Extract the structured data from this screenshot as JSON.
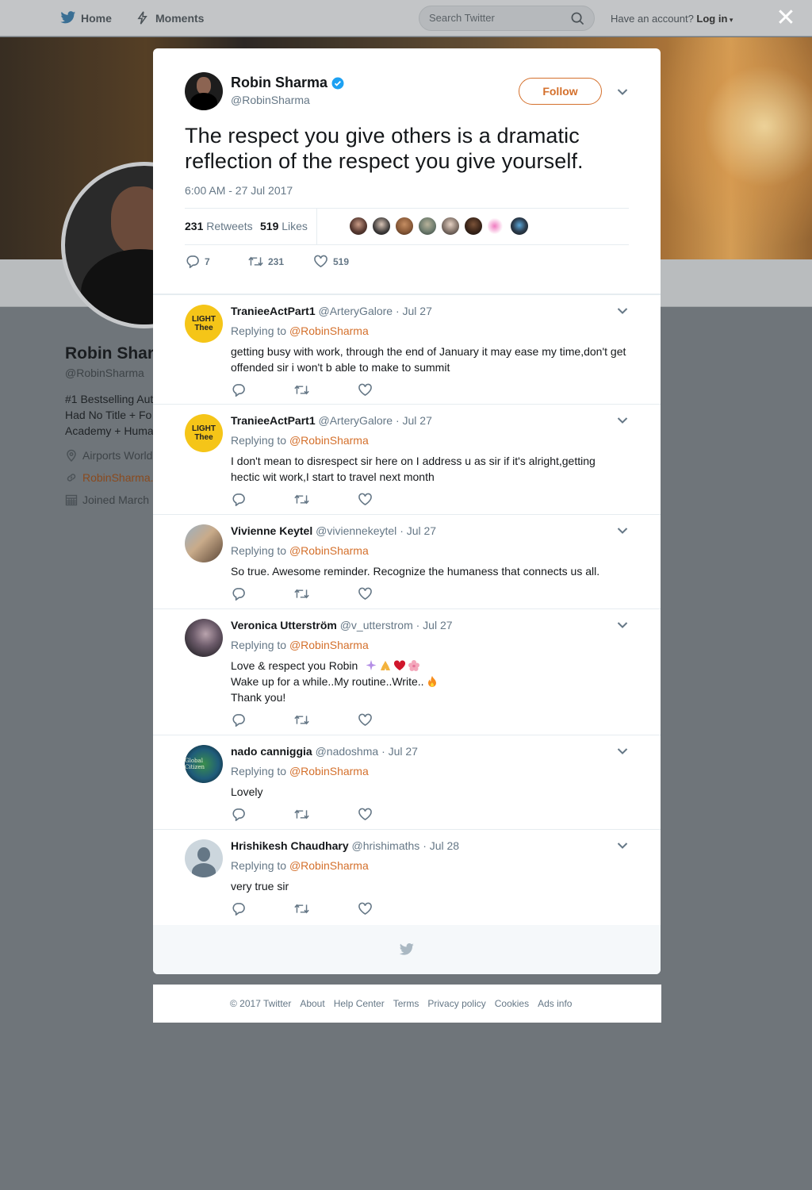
{
  "nav": {
    "home": "Home",
    "moments": "Moments",
    "search_placeholder": "Search Twitter",
    "account_prompt": "Have an account?",
    "login": "Log in"
  },
  "profile": {
    "name": "Robin Shar",
    "handle": "@RobinSharma",
    "bio": [
      "#1 Bestselling Aut",
      "Had No Title + Fo",
      "Academy + Huma"
    ],
    "location": "Airports World",
    "website": "RobinSharma.",
    "joined": "Joined March"
  },
  "tweet": {
    "name": "Robin Sharma",
    "handle": "@RobinSharma",
    "follow_label": "Follow",
    "text": "The respect you give others is a dramatic reflection of the respect you give yourself.",
    "timestamp": "6:00 AM - 27 Jul 2017",
    "retweets_count": "231",
    "retweets_label": "Retweets",
    "likes_count": "519",
    "likes_label": "Likes",
    "reply_count": "7",
    "retweet_count": "231",
    "like_count": "519"
  },
  "replies": [
    {
      "name": "TranieeActPart1",
      "handle": "@ArteryGalore",
      "date": "· Jul 27",
      "replying_prefix": "Replying to",
      "replying_to": "@RobinSharma",
      "lines": [
        "getting busy with work, through the end of January it may ease my time,don't get offended sir i won't b able to make to summit"
      ],
      "avatar_text": [
        "LIGHT",
        "Thee"
      ]
    },
    {
      "name": "TranieeActPart1",
      "handle": "@ArteryGalore",
      "date": "· Jul 27",
      "replying_prefix": "Replying to",
      "replying_to": "@RobinSharma",
      "lines": [
        "I don't mean to disrespect sir here on I address u as sir if it's alright,getting hectic wit work,I start to travel next month"
      ],
      "avatar_text": [
        "LIGHT",
        "Thee"
      ]
    },
    {
      "name": "Vivienne Keytel",
      "handle": "@viviennekeytel",
      "date": "· Jul 27",
      "replying_prefix": "Replying to",
      "replying_to": "@RobinSharma",
      "lines": [
        "So true. Awesome reminder. Recognize the humaness that connects us all."
      ]
    },
    {
      "name": "Veronica Utterström",
      "handle": "@v_utterstrom",
      "date": "· Jul 27",
      "replying_prefix": "Replying to",
      "replying_to": "@RobinSharma",
      "lines": [
        "Love & respect you Robin",
        "Wake up for a while..My routine..Write..",
        "Thank you!"
      ]
    },
    {
      "name": "nado canniggia",
      "handle": "@nadoshma",
      "date": "· Jul 27",
      "replying_prefix": "Replying to",
      "replying_to": "@RobinSharma",
      "lines": [
        "Lovely"
      ],
      "avatar_text": [
        "Global Citizen"
      ]
    },
    {
      "name": "Hrishikesh Chaudhary",
      "handle": "@hrishimaths",
      "date": "· Jul 28",
      "replying_prefix": "Replying to",
      "replying_to": "@RobinSharma",
      "lines": [
        "very true sir"
      ]
    }
  ],
  "footer": {
    "copyright": "© 2017 Twitter",
    "about": "About",
    "help": "Help Center",
    "terms": "Terms",
    "privacy": "Privacy policy",
    "cookies": "Cookies",
    "ads": "Ads info"
  },
  "colors": {
    "accent": "#d4702c",
    "verified": "#1da1f2",
    "muted_text": "#657786"
  }
}
